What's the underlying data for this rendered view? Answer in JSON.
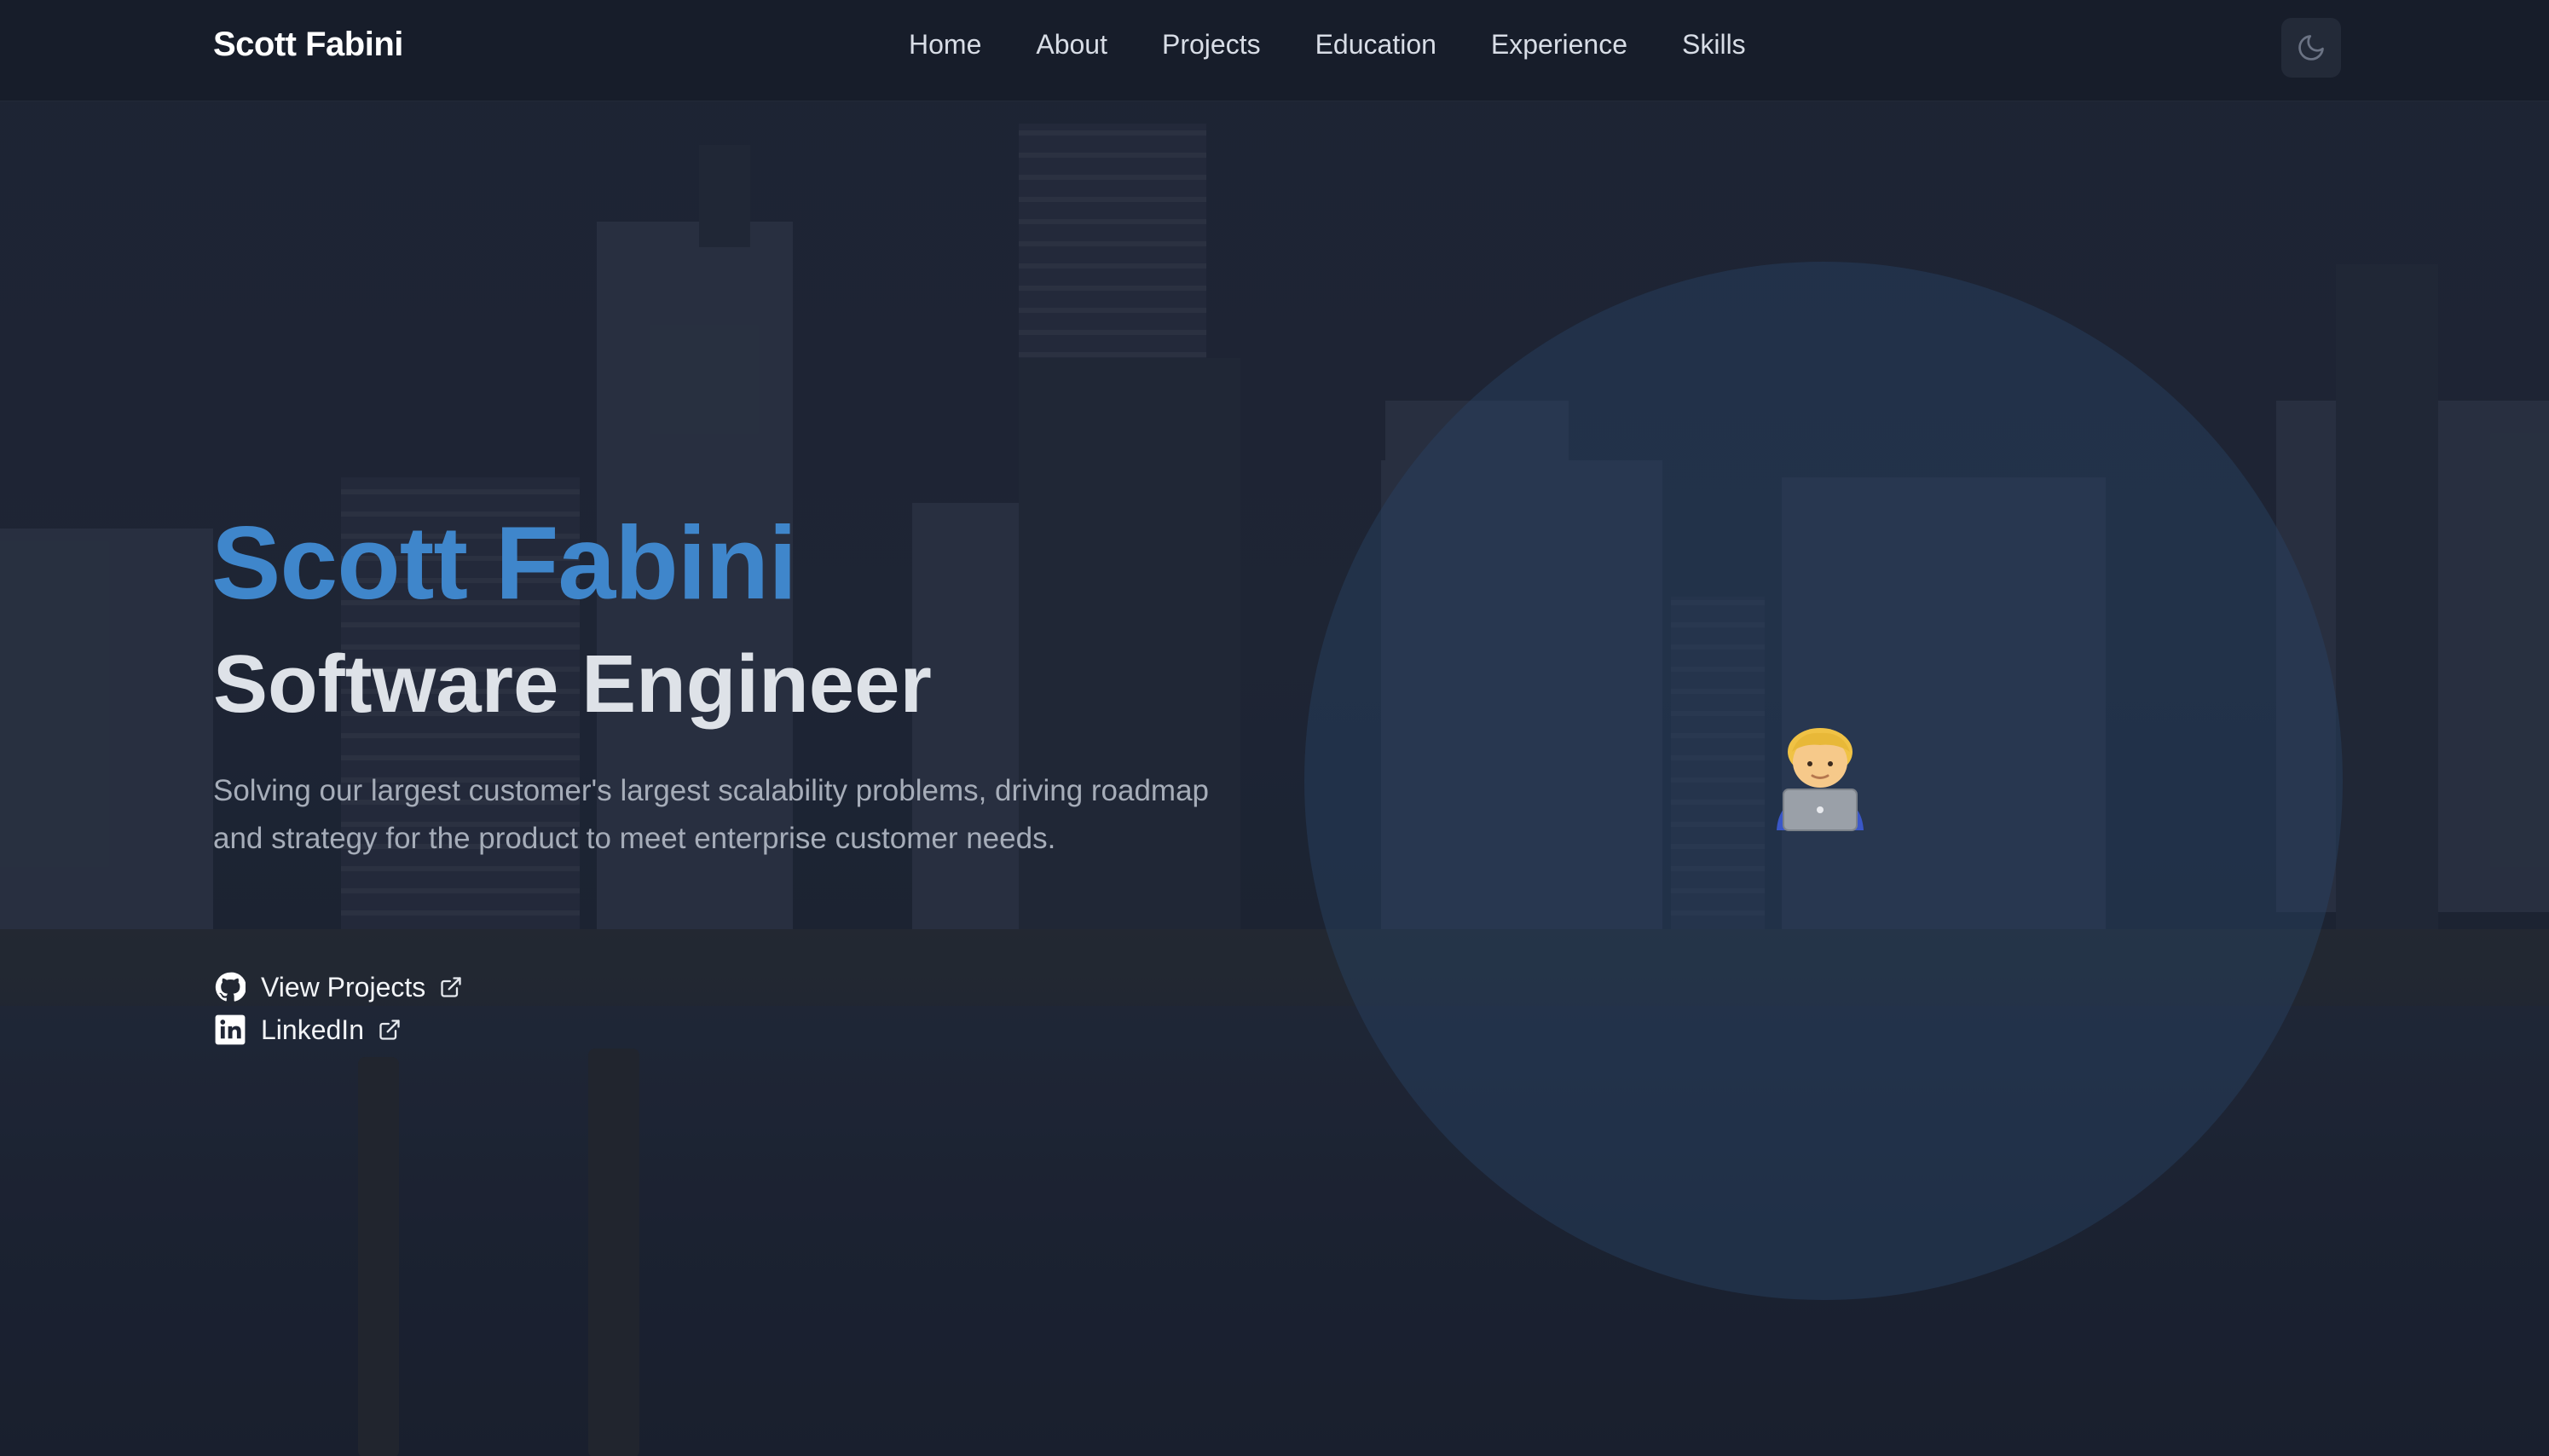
{
  "nav": {
    "brand": "Scott Fabini",
    "items": [
      {
        "label": "Home"
      },
      {
        "label": "About"
      },
      {
        "label": "Projects"
      },
      {
        "label": "Education"
      },
      {
        "label": "Experience"
      },
      {
        "label": "Skills"
      }
    ],
    "theme_toggle_icon": "moon-icon"
  },
  "hero": {
    "name": "Scott Fabini",
    "title": "Software Engineer",
    "description": "Solving our largest customer's largest scalability problems, driving roadmap and strategy for the product to meet enterprise customer needs.",
    "links": [
      {
        "label": "View Projects",
        "icon": "github-icon",
        "external_icon": "external-link-icon"
      },
      {
        "label": "LinkedIn",
        "icon": "linkedin-icon",
        "external_icon": "external-link-icon"
      }
    ],
    "avatar_icon": "technologist-emoji"
  },
  "colors": {
    "accent": "#3f86cb",
    "nav_bg": "#171d2a",
    "title": "#dee2e8",
    "text_muted": "#a6adb9"
  }
}
